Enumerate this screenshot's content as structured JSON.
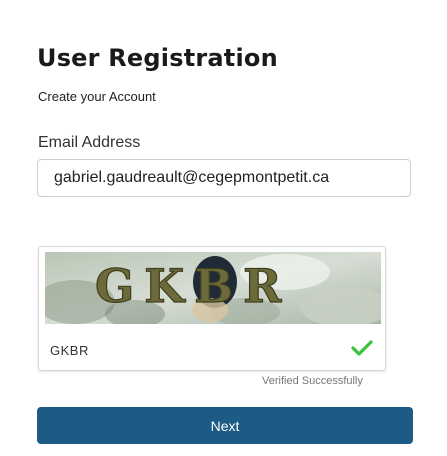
{
  "header": {
    "title": "User Registration",
    "subtitle": "Create your Account"
  },
  "email": {
    "label": "Email Address",
    "value": "gabriel.gaudreault@cegepmontpetit.ca"
  },
  "captcha": {
    "image_text": "GKBR",
    "answer": "GKBR",
    "status_icon": "check-icon",
    "status_text": "Verified Successfully",
    "status_color": "#3cc13b"
  },
  "actions": {
    "next_label": "Next",
    "next_color": "#1c5b85"
  }
}
